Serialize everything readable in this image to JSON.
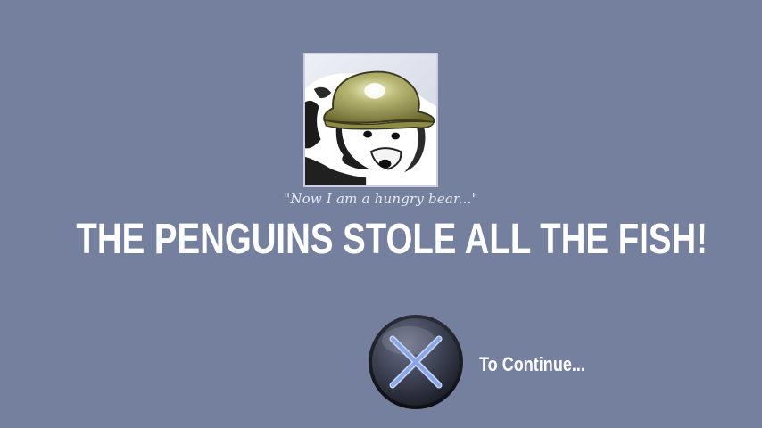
{
  "story": {
    "quote": "\"Now I am a hungry bear...\"",
    "headline": "THE PENGUINS STOLE ALL THE FISH!"
  },
  "prompt": {
    "button_icon": "cross-button-icon",
    "continue_label": "To Continue..."
  },
  "colors": {
    "background": "#75809e",
    "text": "#ffffff",
    "button_cross": "#8aa6e6"
  }
}
